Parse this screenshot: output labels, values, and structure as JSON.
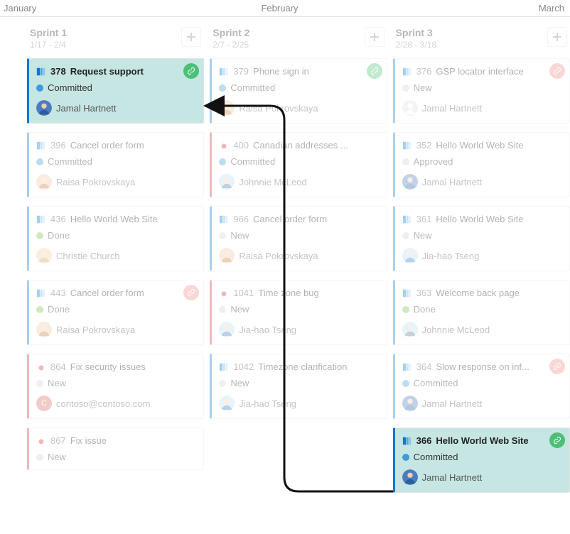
{
  "months": {
    "jan": "January",
    "feb": "February",
    "mar": "March"
  },
  "columns": [
    {
      "title": "Sprint 1",
      "dates": "1/17 - 2/4"
    },
    {
      "title": "Sprint 2",
      "dates": "2/7 - 2/25"
    },
    {
      "title": "Sprint 3",
      "dates": "2/28 - 3/18"
    }
  ],
  "cards": {
    "c378": {
      "id": "378",
      "title": "Request support",
      "state": "Committed",
      "assignee": "Jamal Hartnett"
    },
    "c396": {
      "id": "396",
      "title": "Cancel order form",
      "state": "Committed",
      "assignee": "Raisa Pokrovskaya"
    },
    "c436": {
      "id": "436",
      "title": "Hello World Web Site",
      "state": "Done",
      "assignee": "Christie Church"
    },
    "c443": {
      "id": "443",
      "title": "Cancel order form",
      "state": "Done",
      "assignee": "Raisa Pokrovskaya"
    },
    "c864": {
      "id": "864",
      "title": "Fix security issues",
      "state": "New",
      "assignee": "contoso@contoso.com"
    },
    "c867": {
      "id": "867",
      "title": "Fix issue",
      "state": "New",
      "assignee": ""
    },
    "c379": {
      "id": "379",
      "title": "Phone sign in",
      "state": "Committed",
      "assignee": "Raisa Pokrovskaya"
    },
    "c400": {
      "id": "400",
      "title": "Canadian addresses ...",
      "state": "Committed",
      "assignee": "Johnnie McLeod"
    },
    "c966": {
      "id": "966",
      "title": "Cancel order form",
      "state": "New",
      "assignee": "Raisa Pokrovskaya"
    },
    "c1041": {
      "id": "1041",
      "title": "Time zone bug",
      "state": "New",
      "assignee": "Jia-hao Tseng"
    },
    "c1042": {
      "id": "1042",
      "title": "Timezone clarification",
      "state": "New",
      "assignee": "Jia-hao Tseng"
    },
    "c376": {
      "id": "376",
      "title": "GSP locator interface",
      "state": "New",
      "assignee": "Jamal Hartnett"
    },
    "c352": {
      "id": "352",
      "title": "Hello World Web Site",
      "state": "Approved",
      "assignee": "Jamal Hartnett"
    },
    "c361": {
      "id": "361",
      "title": "Hello World Web Site",
      "state": "New",
      "assignee": "Jia-hao Tseng"
    },
    "c363": {
      "id": "363",
      "title": "Welcome back page",
      "state": "Done",
      "assignee": "Johnnie McLeod"
    },
    "c364": {
      "id": "364",
      "title": "Slow response on inf...",
      "state": "Committed",
      "assignee": "Jamal Hartnett"
    },
    "c366": {
      "id": "366",
      "title": "Hello World Web Site",
      "state": "Committed",
      "assignee": "Jamal Hartnett"
    }
  }
}
